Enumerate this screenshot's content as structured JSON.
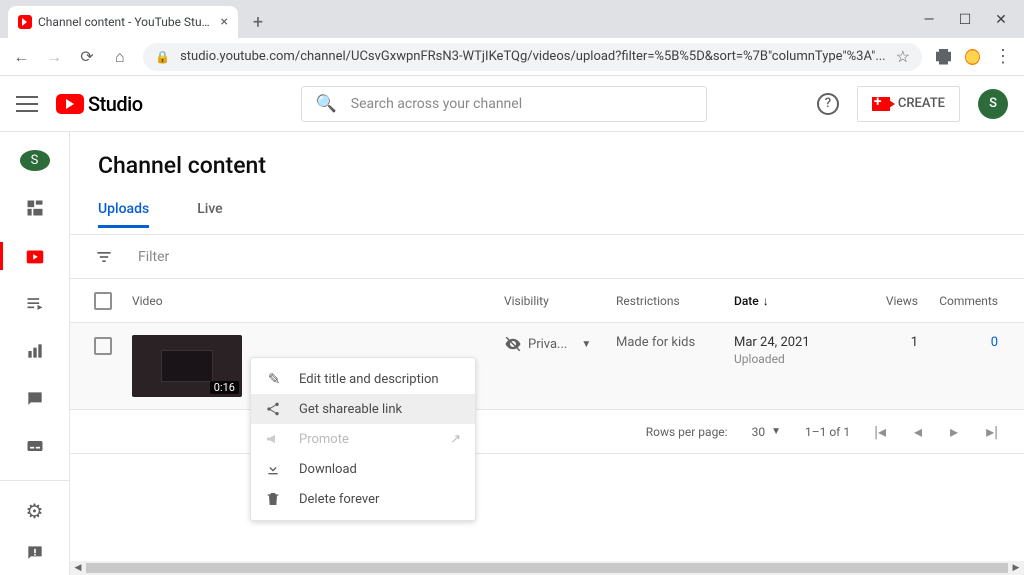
{
  "browser": {
    "tab_title": "Channel content - YouTube Studio",
    "url": "studio.youtube.com/channel/UCsvGxwpnFRsN3-WTjIKeTQg/videos/upload?filter=%5B%5D&sort=%7B\"columnType\"%3A\"..."
  },
  "header": {
    "logo_text": "Studio",
    "search_placeholder": "Search across your channel",
    "create_label": "CREATE",
    "avatar_initial": "S"
  },
  "sidebar": {
    "avatar_initial": "S"
  },
  "page": {
    "title": "Channel content",
    "tabs": {
      "uploads": "Uploads",
      "live": "Live"
    },
    "filter_label": "Filter"
  },
  "table": {
    "headers": {
      "video": "Video",
      "visibility": "Visibility",
      "restrictions": "Restrictions",
      "date": "Date",
      "views": "Views",
      "comments": "Comments"
    },
    "row": {
      "duration": "0:16",
      "visibility": "Priva...",
      "restrictions": "Made for kids",
      "date": "Mar 24, 2021",
      "date_sub": "Uploaded",
      "views": "1",
      "comments": "0"
    }
  },
  "pager": {
    "rows_label": "Rows per page:",
    "rows_value": "30",
    "range": "1–1 of 1"
  },
  "context_menu": {
    "edit": "Edit title and description",
    "share": "Get shareable link",
    "promote": "Promote",
    "download": "Download",
    "delete": "Delete forever"
  }
}
